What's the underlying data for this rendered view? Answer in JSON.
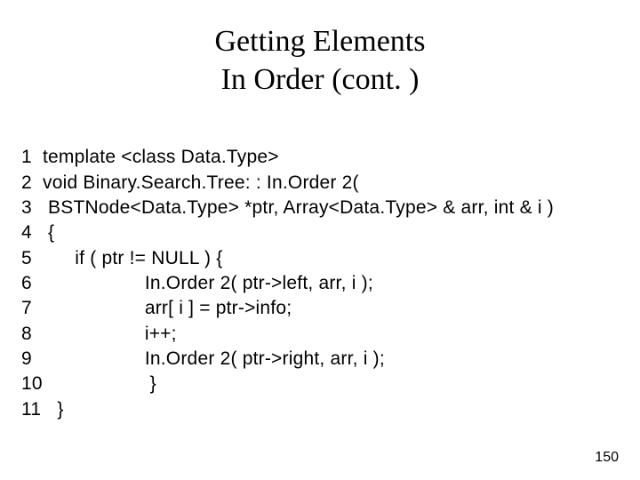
{
  "title_line1": "Getting Elements",
  "title_line2": "In Order (cont. )",
  "code_lines": {
    "l1": "1  template <class Data.Type>",
    "l2": "2  void Binary.Search.Tree: : In.Order 2(",
    "l3": "3   BSTNode<Data.Type> *ptr, Array<Data.Type> & arr, int & i )",
    "l4": "4   {",
    "l5": "5        if ( ptr != NULL ) {",
    "l6": "6                     In.Order 2( ptr->left, arr, i );",
    "l7": "7                     arr[ i ] = ptr->info;",
    "l8": "8                     i++;",
    "l9": "9                     In.Order 2( ptr->right, arr, i );",
    "l10": "10                    }",
    "l11": "11   }"
  },
  "page_number": "150"
}
